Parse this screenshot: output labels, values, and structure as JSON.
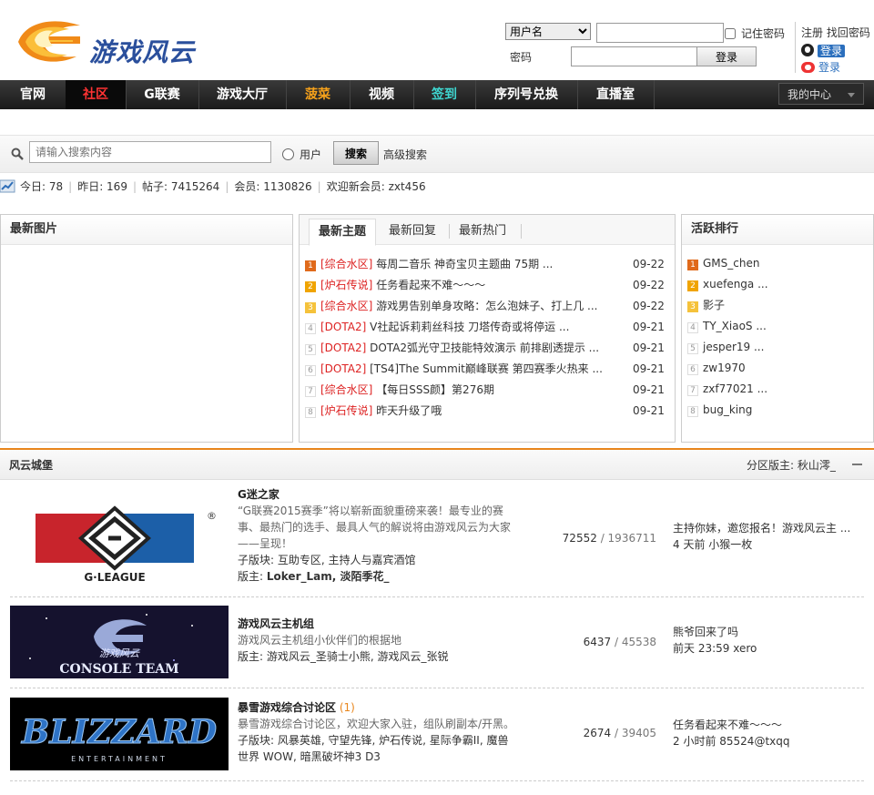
{
  "header": {
    "logo_text": "游戏风云",
    "login": {
      "select_value": "用户名",
      "password_label": "密码",
      "remember_label": "记住密码",
      "login_button": "登录",
      "register_link": "注册",
      "forgot_link": "找回密码",
      "qq_login_badge": "登录",
      "weibo_login_link": "登录"
    }
  },
  "nav": {
    "items": [
      "官网",
      "社区",
      "G联赛",
      "游戏大厅",
      "菠菜",
      "视频",
      "签到",
      "序列号兑换",
      "直播室"
    ],
    "my_center": "我的中心"
  },
  "search": {
    "placeholder": "请输入搜索内容",
    "radio_label": "用户",
    "button": "搜索",
    "advanced": "高级搜索"
  },
  "stats": {
    "today": "今日: 78",
    "yesterday": "昨日: 169",
    "posts": "帖子: 7415264",
    "members": "会员: 1130826",
    "welcome": "欢迎新会员: zxt456"
  },
  "latest_images": {
    "title": "最新图片"
  },
  "topics": {
    "tabs": [
      "最新主题",
      "最新回复",
      "最新热门"
    ],
    "items": [
      {
        "n": "1",
        "tag": "[综合水区]",
        "title": "每周二音乐 神奇宝贝主题曲 75期 ...",
        "date": "09-22"
      },
      {
        "n": "2",
        "tag": "[炉石传说]",
        "title": "任务看起来不难～～～",
        "date": "09-22"
      },
      {
        "n": "3",
        "tag": "[综合水区]",
        "title": "游戏男告别单身攻略：怎么泡妹子、打上几 ...",
        "date": "09-22"
      },
      {
        "n": "4",
        "tag": "[DOTA2]",
        "title": "V社起诉莉莉丝科技 刀塔传奇或将停运 ...",
        "date": "09-21"
      },
      {
        "n": "5",
        "tag": "[DOTA2]",
        "title": "DOTA2弧光守卫技能特效演示 前排剧透提示 ...",
        "date": "09-21"
      },
      {
        "n": "6",
        "tag": "[DOTA2]",
        "title": "[TS4]The Summit巅峰联赛 第四赛季火热来 ...",
        "date": "09-21"
      },
      {
        "n": "7",
        "tag": "[综合水区]",
        "title": "【每日SSS颜】第276期",
        "date": "09-21"
      },
      {
        "n": "8",
        "tag": "[炉石传说]",
        "title": "昨天升级了哦",
        "date": "09-21"
      }
    ]
  },
  "active_rank": {
    "title": "活跃排行",
    "items": [
      {
        "n": "1",
        "name": "GMS_chen"
      },
      {
        "n": "2",
        "name": "xuefenga ..."
      },
      {
        "n": "3",
        "name": "影子"
      },
      {
        "n": "4",
        "name": "TY_XiaoS ..."
      },
      {
        "n": "5",
        "name": "jesper19 ..."
      },
      {
        "n": "6",
        "name": "zw1970"
      },
      {
        "n": "7",
        "name": "zxf77021 ..."
      },
      {
        "n": "8",
        "name": "bug_king"
      }
    ]
  },
  "section": {
    "title": "风云城堡",
    "moderator": "分区版主: 秋山澪_",
    "forums": [
      {
        "name": "G迷之家",
        "desc": "“G联赛2015赛季”将以崭新面貌重磅来袭！最专业的赛事、最热门的选手、最具人气的解说将由游戏风云为大家——呈现！",
        "sub": "子版块: 互助专区, 主持人与嘉宾酒馆",
        "mods_label": "版主:",
        "mods": "Loker_Lam, 淡陌季花_",
        "threads": "72552",
        "posts": "1936711",
        "last_title": "主持你妹，邀您报名！游戏风云主 ...",
        "last_meta": "4 天前 小猴一枚",
        "logo_text": "G·LEAGUE"
      },
      {
        "name": "游戏风云主机组",
        "desc": "游戏风云主机组小伙伴们的根据地",
        "mods_line": "版主: 游戏风云_圣骑士小熊, 游戏风云_张锐",
        "threads": "6437",
        "posts": "45538",
        "last_title": "熊爷回来了吗",
        "last_meta": "前天 23:59 xero",
        "logo_text": "CONSOLE TEAM",
        "logo_sub": "游戏风云"
      },
      {
        "name": "暴雪游戏综合讨论区",
        "name_count": "(1)",
        "desc": "暴雪游戏综合讨论区，欢迎大家入驻，组队刷副本/开黑。",
        "sub": "子版块: 风暴英雄, 守望先锋, 炉石传说, 星际争霸II, 魔兽世界 WOW, 暗黑破坏神3 D3",
        "threads": "2674",
        "posts": "39405",
        "last_title": "任务看起来不难～～～",
        "last_meta": "2 小时前 85524@txqq",
        "logo_text": "BLIZZARD",
        "logo_sub": "ENTERTAINMENT"
      }
    ]
  }
}
